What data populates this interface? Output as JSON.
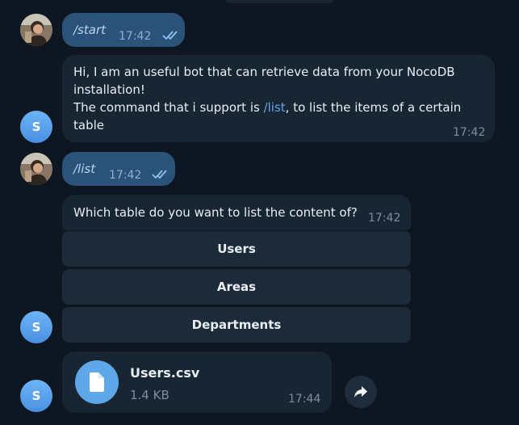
{
  "messages": {
    "m1": {
      "text": "/start",
      "time": "17:42"
    },
    "m2": {
      "line1": "Hi, I am an useful bot that can retrieve data from your NocoDB",
      "line2": "installation!",
      "line3_pre": "The command that i support is ",
      "line3_link": "/list",
      "line3_post": ", to list the items of a certain",
      "line4": "table",
      "time": "17:42"
    },
    "m3": {
      "text": "/list",
      "time": "17:42"
    },
    "m4": {
      "text": "Which table do you want to list the content of?",
      "time": "17:42"
    },
    "keyboard": [
      "Users",
      "Areas",
      "Departments"
    ],
    "file": {
      "name": "Users.csv",
      "size": "1.4 KB",
      "time": "17:44"
    }
  },
  "avatars": {
    "bot_initial": "S"
  },
  "icons": {
    "read": "double-check-icon",
    "file": "document-icon",
    "share": "share-arrow-icon"
  },
  "colors": {
    "background": "#0e1621",
    "incoming_bubble": "#182533",
    "outgoing_bubble": "#2b5278",
    "link": "#63a5eb",
    "avatar": "#5a9fec"
  }
}
